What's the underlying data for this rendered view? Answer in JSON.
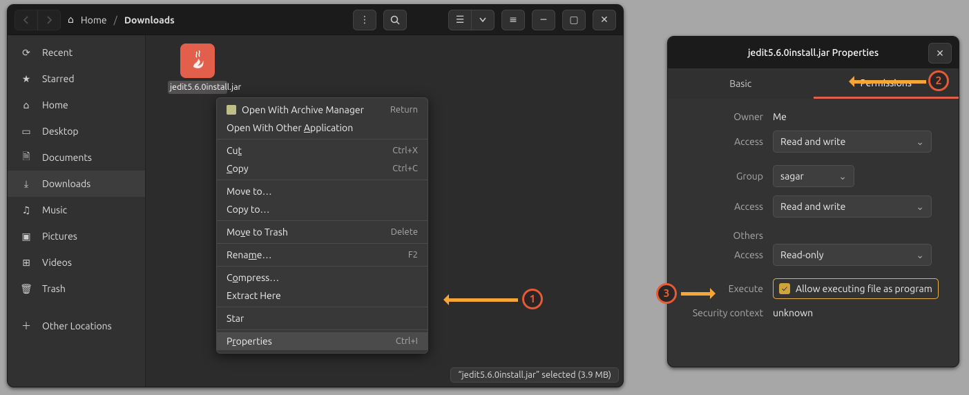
{
  "fm": {
    "breadcrumb_home": "Home",
    "breadcrumb_current": "Downloads",
    "sidebar": [
      {
        "icon": "⟳",
        "label": "Recent"
      },
      {
        "icon": "★",
        "label": "Starred"
      },
      {
        "icon": "⌂",
        "label": "Home"
      },
      {
        "icon": "▭",
        "label": "Desktop"
      },
      {
        "icon": "🗎",
        "label": "Documents"
      },
      {
        "icon": "⤓",
        "label": "Downloads"
      },
      {
        "icon": "♫",
        "label": "Music"
      },
      {
        "icon": "▣",
        "label": "Pictures"
      },
      {
        "icon": "⊞",
        "label": "Videos"
      },
      {
        "icon": "🗑",
        "label": "Trash"
      },
      {
        "icon": "＋",
        "label": "Other Locations"
      }
    ],
    "file_label": "jedit5.6.0install.jar",
    "statusbar": "“jedit5.6.0install.jar” selected  (3.9 MB)"
  },
  "ctx": {
    "open_archive": "Open With Archive Manager",
    "open_archive_sc": "Return",
    "open_other_pre": "Open With Other ",
    "open_other_u": "A",
    "open_other_post": "pplication",
    "cut": "Cu",
    "cut_u": "t",
    "cut_sc": "Ctrl+X",
    "copy_u": "C",
    "copy_post": "opy",
    "copy_sc": "Ctrl+C",
    "moveto": "Move to…",
    "copyto": "Copy to…",
    "trash_pre": "Mo",
    "trash_u": "v",
    "trash_post": "e to Trash",
    "trash_sc": "Delete",
    "rename_pre": "Rena",
    "rename_u": "m",
    "rename_post": "e…",
    "rename_sc": "F2",
    "compress_pre": "C",
    "compress_u": "o",
    "compress_post": "mpress…",
    "extract": "Extract Here",
    "star": "Star",
    "properties_pre": "P",
    "properties_u": "r",
    "properties_post": "operties",
    "properties_sc": "Ctrl+I"
  },
  "prop": {
    "title": "jedit5.6.0install.jar Properties",
    "tab_basic": "Basic",
    "tab_perm": "Permissions",
    "owner_lab": "Owner",
    "owner_val": "Me",
    "o_access_lab": "Access",
    "o_access_val": "Read and write",
    "group_lab": "Group",
    "group_val": "sagar",
    "g_access_lab": "Access",
    "g_access_val": "Read and write",
    "others_lab": "Others",
    "ot_access_lab": "Access",
    "ot_access_val": "Read-only",
    "execute_lab": "Execute",
    "execute_val": "Allow executing file as program",
    "sec_lab": "Security context",
    "sec_val": "unknown"
  },
  "ann": {
    "n1": "1",
    "n2": "2",
    "n3": "3"
  }
}
